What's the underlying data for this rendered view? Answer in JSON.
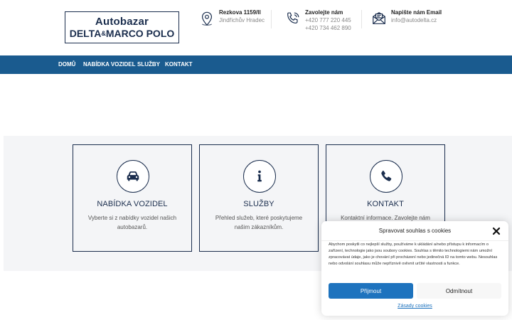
{
  "logo": {
    "line1": "Autobazar",
    "line2a": "DELTA",
    "amp": "&",
    "line2b": "MARCO POLO"
  },
  "contacts": [
    {
      "title": "Rezkova 1159/II",
      "lines": [
        "Jindřichův Hradec"
      ],
      "icon": "map-pin-icon"
    },
    {
      "title": "Zavolejte nám",
      "lines": [
        "+420 777 220 445",
        "+420 734 462 890"
      ],
      "icon": "phone-icon"
    },
    {
      "title": "Napište nám Email",
      "lines": [
        "info@autodelta.cz"
      ],
      "icon": "envelope-icon"
    }
  ],
  "nav": [
    {
      "label": "Domů"
    },
    {
      "label": "Nabídka vozidel"
    },
    {
      "label": "Služby"
    },
    {
      "label": "Kontakt"
    }
  ],
  "cards": [
    {
      "title": "Nabídka vozidel",
      "desc": "Vyberte si z nabídky vozidel našich autobazarů.",
      "icon": "car-icon"
    },
    {
      "title": "Služby",
      "desc": "Přehled služeb, které poskytujeme našim zákazníkům.",
      "icon": "info-icon"
    },
    {
      "title": "Kontakt",
      "desc": "Kontaktní informace. Zavolejte nám",
      "icon": "phone-icon"
    }
  ],
  "cookie": {
    "title": "Spravovat souhlas s cookies",
    "body": "Abychom poskytli co nejlepší služby, používáme k ukládání a/nebo přístupu k informacím o zařízení, technologie jako jsou soubory cookies. Souhlas s těmito technologiemi nám umožní zpracovávat údaje, jako je chování při procházení nebo jedinečná ID na tomto webu. Nesouhlas nebo odvolání souhlasu může nepříznivě ovlivnit určité vlastnosti a funkce.",
    "accept": "Přijmout",
    "deny": "Odmítnout",
    "policy": "Zásady cookies"
  },
  "colors": {
    "brand_dark": "#1a2d4d",
    "nav_blue": "#1a5b8f",
    "accent": "#1e73be"
  }
}
